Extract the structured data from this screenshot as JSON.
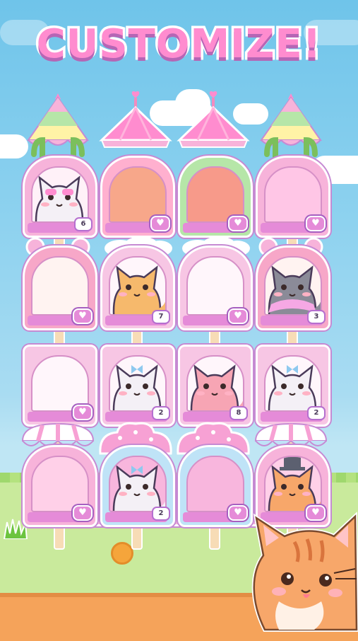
{
  "screen": {
    "title": "CUSTOMIZE!"
  },
  "colors": {
    "title_pink": "#ff8ccf",
    "outline_purple": "#b566b5",
    "sky": "#8ed2ef",
    "heart_button": "#e58bd8"
  },
  "stands": [
    {
      "row": 0,
      "col": 0,
      "theme": "carousel-cactus",
      "content": "cat-with-pink-sunglasses",
      "count": "6"
    },
    {
      "row": 0,
      "col": 1,
      "theme": "tent-peach",
      "content": "empty",
      "count": ""
    },
    {
      "row": 0,
      "col": 2,
      "theme": "tent-green-coral",
      "content": "empty",
      "count": ""
    },
    {
      "row": 0,
      "col": 3,
      "theme": "carousel-cactus-pink",
      "content": "empty",
      "count": ""
    },
    {
      "row": 1,
      "col": 0,
      "theme": "bear-ears",
      "content": "empty",
      "count": ""
    },
    {
      "row": 1,
      "col": 1,
      "theme": "clouds-stars",
      "content": "shiba-cat",
      "count": "7"
    },
    {
      "row": 1,
      "col": 2,
      "theme": "clouds-stars",
      "content": "empty",
      "count": ""
    },
    {
      "row": 1,
      "col": 3,
      "theme": "bear-ears",
      "content": "gray-cat-with-tutu",
      "count": "3"
    },
    {
      "row": 2,
      "col": 0,
      "theme": "frame",
      "content": "empty",
      "count": ""
    },
    {
      "row": 2,
      "col": 1,
      "theme": "frame",
      "content": "white-cat-with-bow",
      "count": "2"
    },
    {
      "row": 2,
      "col": 2,
      "theme": "frame",
      "content": "pink-sleeping-cat",
      "count": "8"
    },
    {
      "row": 2,
      "col": 3,
      "theme": "frame",
      "content": "white-cat-with-bow",
      "count": "2"
    },
    {
      "row": 3,
      "col": 0,
      "theme": "awning",
      "content": "empty",
      "count": ""
    },
    {
      "row": 3,
      "col": 1,
      "theme": "cupcake",
      "content": "white-cat-with-bow",
      "count": "2"
    },
    {
      "row": 3,
      "col": 2,
      "theme": "cupcake",
      "content": "empty",
      "count": ""
    },
    {
      "row": 3,
      "col": 3,
      "theme": "awning",
      "content": "orange-cat-with-top-hat",
      "count": ""
    }
  ],
  "icons": {
    "heart_button": "heart-icon",
    "mascot": "orange-tabby-cat"
  }
}
